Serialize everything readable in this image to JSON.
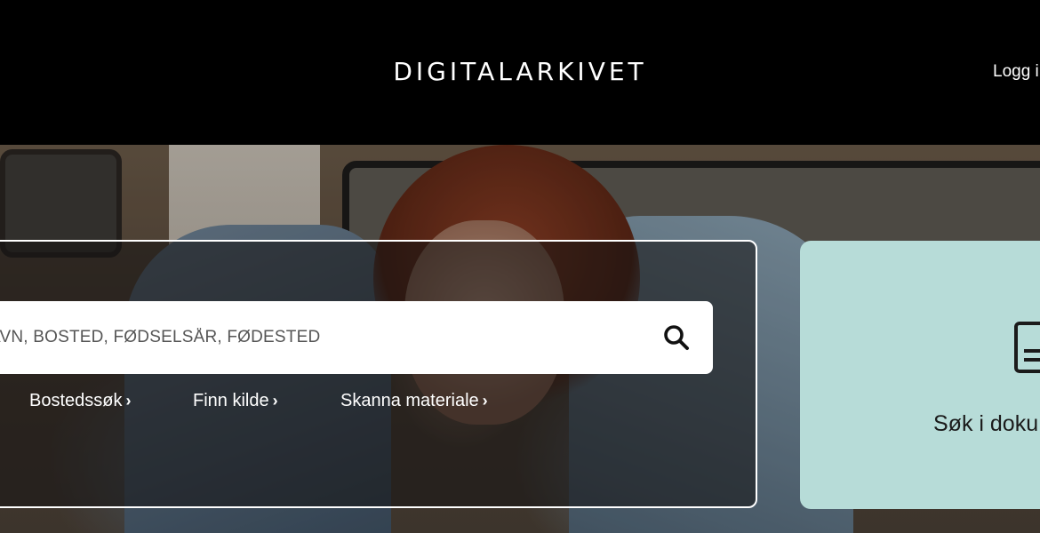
{
  "header": {
    "logo": "DIGITALARKIVET",
    "login_label": "Logg i"
  },
  "search": {
    "placeholder": "AVN, BOSTED, FØDSELSÅR, FØDESTED",
    "button_icon": "search-icon"
  },
  "links": [
    {
      "label": "Bostedssøk",
      "icon": "chevron-right-icon"
    },
    {
      "label": "Finn kilde",
      "icon": "chevron-right-icon"
    },
    {
      "label": "Skanna materiale",
      "icon": "chevron-right-icon"
    }
  ],
  "doc_card": {
    "label": "Søk i doku",
    "icon": "document-icon"
  },
  "colors": {
    "header_bg": "#000000",
    "doc_card_bg": "#b7dcd8",
    "text_light": "#ffffff"
  }
}
